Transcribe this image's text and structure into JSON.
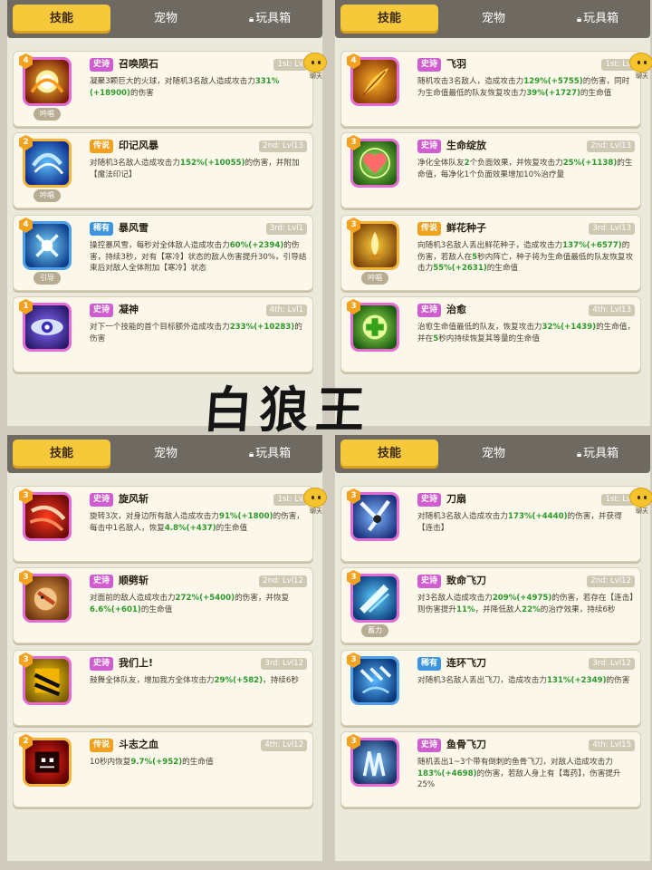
{
  "tabs": {
    "skills": "技能",
    "pets": "宠物",
    "toybox": "玩具箱",
    "lock_icon": "lock-icon"
  },
  "chat_label": "聊天",
  "title_text": "白狼王",
  "panels": [
    {
      "cards": [
        {
          "badge": "4",
          "rarity": "史诗",
          "rarity_class": "r-epic",
          "name": "召唤陨石",
          "slot": "1st: Lv",
          "tag": "吟唱",
          "icon": "meteor-icon",
          "frame": "pink",
          "desc": [
            [
              "凝聚3颗巨大的火球，对随机3名敌人造成攻击力",
              ""
            ],
            [
              "331%(+189",
              "g"
            ],
            [
              "",
              ""
            ],
            [
              "00)",
              "g"
            ],
            [
              "的伤害",
              ""
            ]
          ]
        },
        {
          "badge": "2",
          "rarity": "传说",
          "rarity_class": "r-legend",
          "name": "印记风暴",
          "slot": "2nd: Lvl13",
          "tag": "吟唱",
          "icon": "mark-storm-icon",
          "frame": "gold",
          "desc": [
            [
              "对随机3名敌人造成攻击力",
              ""
            ],
            [
              "152%(+10055)",
              "g"
            ],
            [
              "的伤害，并附加【魔法印记】",
              ""
            ]
          ]
        },
        {
          "badge": "4",
          "rarity": "稀有",
          "rarity_class": "r-rare",
          "name": "暴风雪",
          "slot": "3rd: Lvl1",
          "tag": "引导",
          "icon": "blizzard-icon",
          "frame": "blue",
          "desc": [
            [
              "操控暴风雪，每秒对全体敌人造成攻击力",
              ""
            ],
            [
              "60%(+2394)",
              "g"
            ],
            [
              "的伤害，持续3秒，对有【寒冷】状态的敌人伤害提升30%，引导结束后对敌人全体附加【寒冷】状态",
              ""
            ]
          ]
        },
        {
          "badge": "1",
          "rarity": "史诗",
          "rarity_class": "r-epic",
          "name": "凝神",
          "slot": "4th: Lvl1",
          "tag": "",
          "icon": "focus-eye-icon",
          "frame": "pink",
          "desc": [
            [
              "对下一个技能的首个目标额外造成攻击力",
              ""
            ],
            [
              "233%(+10283)",
              "g"
            ],
            [
              "的伤害",
              ""
            ]
          ]
        }
      ]
    },
    {
      "cards": [
        {
          "badge": "4",
          "rarity": "史诗",
          "rarity_class": "r-epic",
          "name": "飞羽",
          "slot": "1st: Lv",
          "tag": "",
          "icon": "feather-icon",
          "frame": "pink",
          "desc": [
            [
              "随机攻击3名敌人，造成攻击力",
              ""
            ],
            [
              "129%(+5755)",
              "g"
            ],
            [
              "的伤害，同时为生命值最低的队友恢复攻击力",
              ""
            ],
            [
              "39%(+1727)",
              "g"
            ],
            [
              "的生命值",
              ""
            ]
          ]
        },
        {
          "badge": "3",
          "rarity": "史诗",
          "rarity_class": "r-epic",
          "name": "生命绽放",
          "slot": "2nd: Lvl13",
          "tag": "",
          "icon": "heart-bloom-icon",
          "frame": "pink",
          "desc": [
            [
              "净化全体队友",
              ""
            ],
            [
              "2",
              "g"
            ],
            [
              "个负面效果，并恢复攻击力",
              ""
            ],
            [
              "25%(+1138)",
              "g"
            ],
            [
              "的生命值，每净化1个负面效果增加10%治疗量",
              ""
            ]
          ]
        },
        {
          "badge": "3",
          "rarity": "传说",
          "rarity_class": "r-legend",
          "name": "鲜花种子",
          "slot": "3rd: Lvl13",
          "tag": "吟唱",
          "icon": "flower-seed-icon",
          "frame": "gold",
          "desc": [
            [
              "向随机3名敌人丢出鲜花种子，造成攻击力",
              ""
            ],
            [
              "137%(+6577)",
              "g"
            ],
            [
              "的伤害，若敌人在",
              ""
            ],
            [
              "5",
              "g"
            ],
            [
              "秒内阵亡，种子将为生命值最低的队友恢复攻击力",
              ""
            ],
            [
              "55%(+2631)",
              "g"
            ],
            [
              "的生命值",
              ""
            ]
          ]
        },
        {
          "badge": "3",
          "rarity": "史诗",
          "rarity_class": "r-epic",
          "name": "治愈",
          "slot": "4th: Lvl13",
          "tag": "",
          "icon": "heal-cross-icon",
          "frame": "pink",
          "desc": [
            [
              "治愈生命值最低的队友，恢复攻击力",
              ""
            ],
            [
              "32%(+1439)",
              "g"
            ],
            [
              "的生命值，并在",
              ""
            ],
            [
              "5",
              "g"
            ],
            [
              "秒内持续恢复其等量的生命值",
              ""
            ]
          ]
        }
      ]
    },
    {
      "cards": [
        {
          "badge": "3",
          "rarity": "史诗",
          "rarity_class": "r-epic",
          "name": "旋风斩",
          "slot": "1st: Lv",
          "tag": "",
          "icon": "whirlwind-slash-icon",
          "frame": "pink",
          "desc": [
            [
              "旋转3次，对身边所有敌人造成攻击力",
              ""
            ],
            [
              "91%(+1800)",
              "g"
            ],
            [
              "的伤害，每击中1名敌人，恢复",
              ""
            ],
            [
              "4.8%(+437)",
              "g"
            ],
            [
              "的生命值",
              ""
            ]
          ]
        },
        {
          "badge": "3",
          "rarity": "史诗",
          "rarity_class": "r-epic",
          "name": "顺劈斩",
          "slot": "2nd: Lvl12",
          "tag": "",
          "icon": "cleave-icon",
          "frame": "pink",
          "desc": [
            [
              "对面前的敌人造成攻击力",
              ""
            ],
            [
              "272%(+5400)",
              "g"
            ],
            [
              "的伤害，并恢复",
              ""
            ],
            [
              "6.6%(+601)",
              "g"
            ],
            [
              "的生命值",
              ""
            ]
          ]
        },
        {
          "badge": "3",
          "rarity": "史诗",
          "rarity_class": "r-epic",
          "name": "我们上!",
          "slot": "3rd: Lvl12",
          "tag": "",
          "icon": "rally-icon",
          "frame": "pink",
          "desc": [
            [
              "鼓舞全体队友，增加我方全体攻击力",
              ""
            ],
            [
              "29%(+582)",
              "g"
            ],
            [
              "，持续6秒",
              ""
            ]
          ]
        },
        {
          "badge": "2",
          "rarity": "传说",
          "rarity_class": "r-legend",
          "name": "斗志之血",
          "slot": "4th: Lvl12",
          "tag": "",
          "icon": "fighting-blood-icon",
          "frame": "gold",
          "desc": [
            [
              "10秒内恢复",
              ""
            ],
            [
              "9.7%(+952)",
              "g"
            ],
            [
              "的生命值",
              ""
            ]
          ]
        }
      ]
    },
    {
      "cards": [
        {
          "badge": "3",
          "rarity": "史诗",
          "rarity_class": "r-epic",
          "name": "刀扇",
          "slot": "1st: Lv",
          "tag": "",
          "icon": "blade-fan-icon",
          "frame": "pink",
          "desc": [
            [
              "对随机3名敌人造成攻击力",
              ""
            ],
            [
              "173%(+4440)",
              "g"
            ],
            [
              "的伤害，并获得【连击】",
              ""
            ]
          ]
        },
        {
          "badge": "3",
          "rarity": "史诗",
          "rarity_class": "r-epic",
          "name": "致命飞刀",
          "slot": "2nd: Lvl12",
          "tag": "蓄力",
          "icon": "deadly-knife-icon",
          "frame": "pink",
          "desc": [
            [
              "对3名敌人造成攻击力",
              ""
            ],
            [
              "209%(+4975)",
              "g"
            ],
            [
              "的伤害，若存在【连击】则伤害提升",
              ""
            ],
            [
              "11%",
              "g"
            ],
            [
              "，并降低敌人",
              ""
            ],
            [
              "22%",
              "g"
            ],
            [
              "的治疗效果，持续6秒",
              ""
            ]
          ]
        },
        {
          "badge": "3",
          "rarity": "稀有",
          "rarity_class": "r-rare",
          "name": "连环飞刀",
          "slot": "3rd: Lvl12",
          "tag": "",
          "icon": "chain-knives-icon",
          "frame": "blue",
          "desc": [
            [
              "对随机3名敌人丢出飞刀，造成攻击力",
              ""
            ],
            [
              "131%(+2349)",
              "g"
            ],
            [
              "的伤害",
              ""
            ]
          ]
        },
        {
          "badge": "3",
          "rarity": "史诗",
          "rarity_class": "r-epic",
          "name": "鱼骨飞刀",
          "slot": "4th: Lvl15",
          "tag": "",
          "icon": "fishbone-knife-icon",
          "frame": "pink",
          "desc": [
            [
              "随机丢出1~3个带有倒刺的鱼骨飞刀，对敌人造成攻击力",
              ""
            ],
            [
              "183%(+4698)",
              "g"
            ],
            [
              "的伤害，若敌人身上有【毒药】，伤害提升25%",
              ""
            ]
          ]
        }
      ]
    }
  ]
}
